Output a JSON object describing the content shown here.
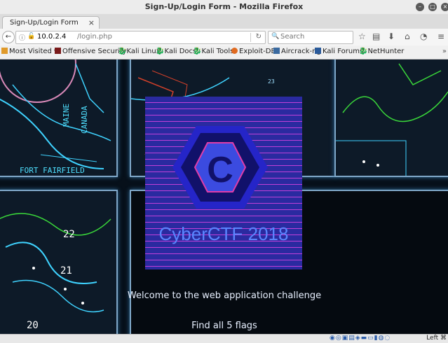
{
  "window": {
    "title": "Sign-Up/Login Form - Mozilla Firefox"
  },
  "tab": {
    "label": "Sign-Up/Login Form",
    "close": "×",
    "new": "+"
  },
  "nav": {
    "url_host": "10.0.2.4",
    "url_path": "/login.php",
    "search_placeholder": "Search"
  },
  "bookmarks": [
    {
      "label": "Most Visited",
      "icon": "folder-icon"
    },
    {
      "label": "Offensive Security",
      "icon": "offsec-icon"
    },
    {
      "label": "Kali Linux",
      "icon": "kali-icon"
    },
    {
      "label": "Kali Docs",
      "icon": "kali-icon"
    },
    {
      "label": "Kali Tools",
      "icon": "kali-icon"
    },
    {
      "label": "Exploit-DB",
      "icon": "exploitdb-icon"
    },
    {
      "label": "Aircrack-ng",
      "icon": "aircrack-icon"
    },
    {
      "label": "Kali Forums",
      "icon": "forums-icon"
    },
    {
      "label": "NetHunter",
      "icon": "kali-icon"
    }
  ],
  "page": {
    "logo_text": "CyberCTF 2018",
    "welcome": "Welcome to the web application challenge",
    "flags": "Find all 5 flags",
    "map_labels": [
      "MAINE",
      "CANADA",
      "FORT FAIRFIELD",
      "23",
      "22",
      "21",
      "20"
    ]
  },
  "status": {
    "keyboard": "Left ⌘"
  },
  "colors": {
    "accent": "#5a86ff",
    "cover_bg": "#2a2aa0",
    "cover_lines": "#c23fd8",
    "hex_outer": "#2525c8",
    "hex_inner": "#11116a",
    "c_fill": "#3b4be0",
    "c_stroke": "#e03ca8"
  }
}
